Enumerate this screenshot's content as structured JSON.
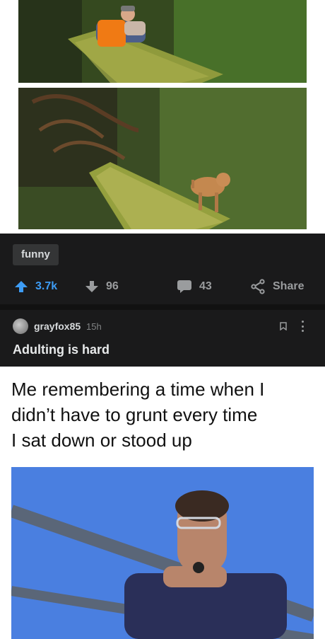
{
  "post": {
    "flair": "funny",
    "upvotes": "3.7k",
    "downvotes": "96",
    "comments": "43",
    "share_label": "Share"
  },
  "comment": {
    "username": "grayfox85",
    "age": "15h",
    "text": "Adulting is hard"
  },
  "meme": {
    "caption_lines": [
      "Me remembering a time when I",
      "didn’t have to grunt every time",
      "I sat down or stood up"
    ]
  },
  "colors": {
    "upvote_accent": "#3d9cf5",
    "dark_bg": "#1a1a1b"
  }
}
